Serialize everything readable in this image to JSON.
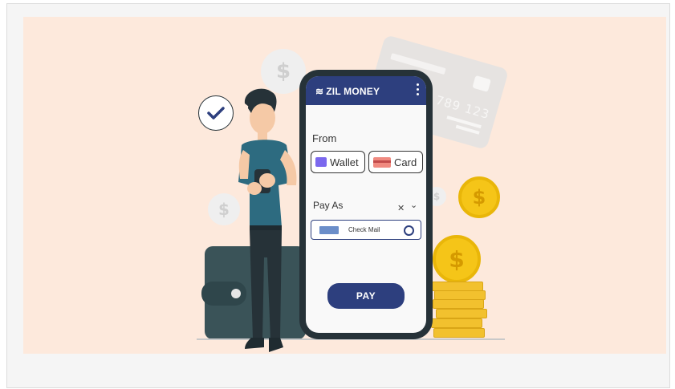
{
  "phone": {
    "brand": "ZIL MONEY",
    "from_label": "From",
    "wallet_label": "Wallet",
    "card_label": "Card",
    "pay_as_label": "Pay As",
    "clear_glyph": "✕",
    "chevron_glyph": "⌄",
    "method_label": "Check Mail",
    "pay_button": "PAY"
  },
  "card": {
    "number": "789 123"
  },
  "coin_symbol": "$",
  "colors": {
    "banner_bg": "#fde9dc",
    "brand_blue": "#2d3f7e",
    "phone_body": "#263238",
    "gold": "#f5c518",
    "shirt": "#2d6b80"
  },
  "icons": [
    "checkmark-icon",
    "wallet-icon",
    "card-icon",
    "check-icon",
    "radio-icon",
    "kebab-menu-icon",
    "dollar-coin-icon"
  ]
}
